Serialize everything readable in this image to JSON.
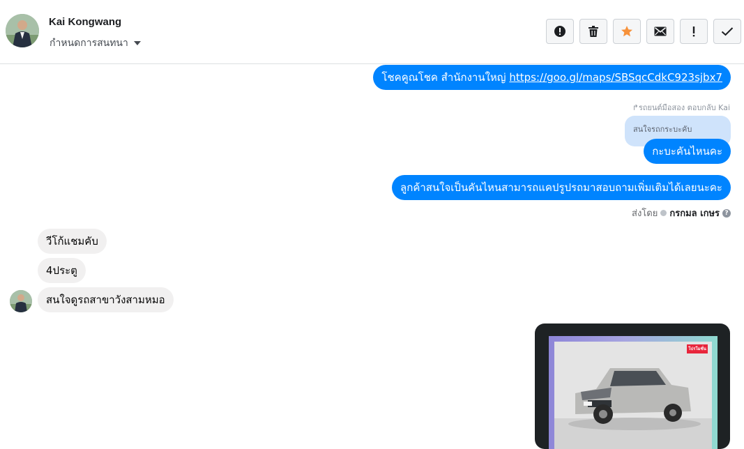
{
  "header": {
    "contact_name": "Kai Kongwang",
    "assign_label": "กำหนดการสนทนา",
    "actions": [
      {
        "icon": "alert-circle-icon"
      },
      {
        "icon": "trash-icon"
      },
      {
        "icon": "star-icon",
        "color": "#f7923b"
      },
      {
        "icon": "mail-icon"
      },
      {
        "icon": "exclamation-icon"
      },
      {
        "icon": "check-icon"
      }
    ]
  },
  "messages": {
    "m1_text": "โชคคูณโชค สำนักงานใหญ่ ",
    "m1_link": "https://goo.gl/maps/SBSqcCdkC923sjbx7",
    "reply_note": "รถยนต์มือสอง ตอบกลับ Kai",
    "quoted_text": "สนใจรถกระบะคับ",
    "m2_text": "กะบะคันไหนคะ",
    "m3_text": "ลูกค้าสนใจเป็นคันไหนสามารถแคปรูปรถมาสอบถามเพิ่มเติมได้เลยนะคะ",
    "sent_by_label": "ส่งโดย",
    "sent_by_name": "กรกมล เกษร",
    "in1_text": "วีโก้แชมคับ",
    "in2_text": "4ประตู",
    "in3_text": "สนใจดูรถสาขาวังสามหมอ",
    "image_badge": "โปรโมชั่น",
    "colors": {
      "outgoing": "#0084ff",
      "incoming": "#f1f0f0",
      "quote": "#cfe3fb"
    }
  }
}
